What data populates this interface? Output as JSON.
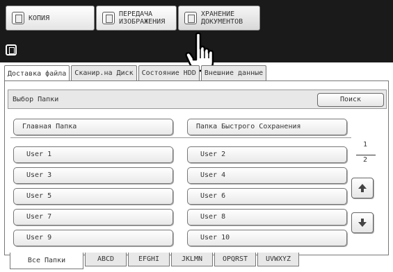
{
  "mode_buttons": {
    "copy": "КОПИЯ",
    "send": "ПЕРЕДАЧА\nИЗОБРАЖЕНИЯ",
    "store": "ХРАНЕНИЕ\nДОКУМЕНТОВ"
  },
  "tabs": [
    "Доставка файла",
    "Сканир.на Диск",
    "Состояние HDD",
    "Внешние данные"
  ],
  "folder_bar": {
    "title": "Выбор Папки",
    "search": "Поиск"
  },
  "main_folders": {
    "main": "Главная Папка",
    "quick": "Папка Быстрого Сохранения"
  },
  "users": [
    "User 1",
    "User 2",
    "User 3",
    "User 4",
    "User 5",
    "User 6",
    "User 7",
    "User 8",
    "User 9",
    "User 10"
  ],
  "pager": {
    "current": "1",
    "total": "2"
  },
  "bottom_tabs": [
    "Все Папки",
    "ABCD",
    "EFGHI",
    "JKLMN",
    "OPQRST",
    "UVWXYZ"
  ],
  "icons": [
    "copy-icon",
    "send-icon",
    "store-icon",
    "document-icon",
    "hand-pointer-icon",
    "arrow-up-icon",
    "arrow-down-icon"
  ]
}
